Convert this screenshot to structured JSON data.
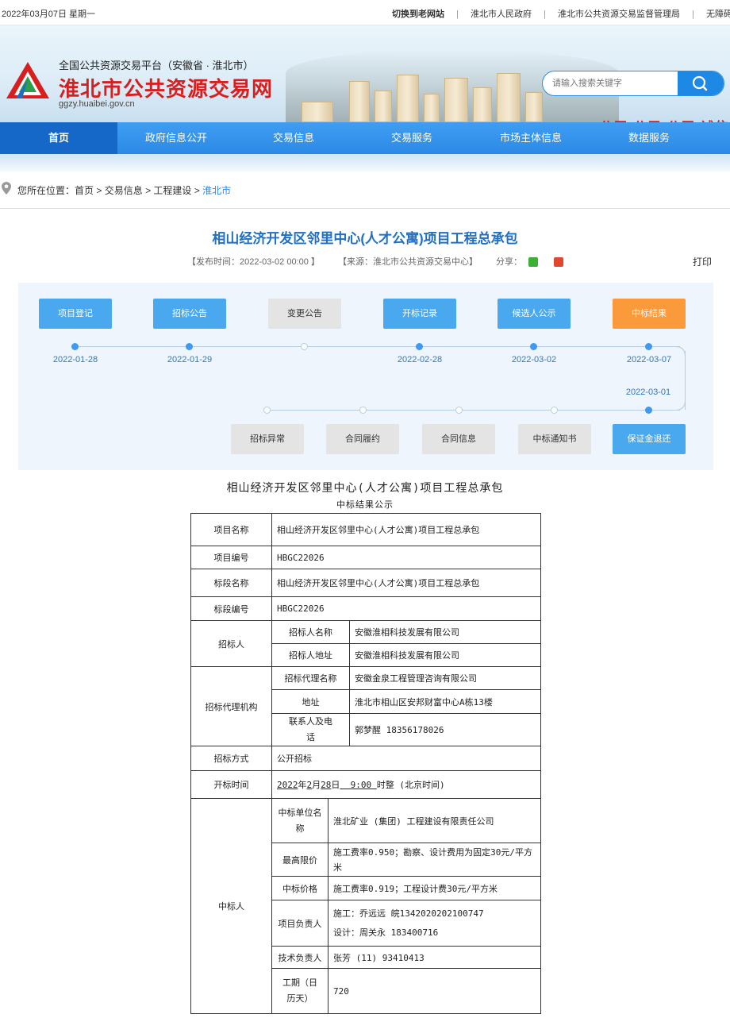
{
  "topbar": {
    "date": "2022年03月07日  星期一",
    "links": [
      "切换到老网站",
      "淮北市人民政府",
      "淮北市公共资源交易监督管理局",
      "无障碍"
    ]
  },
  "header": {
    "platform": "全国公共资源交易平台（安徽省 · 淮北市）",
    "site_title": "淮北市公共资源交易网",
    "site_url": "ggzy.huaibei.gov.cn",
    "slogan": "公开 公平 公正 诚信",
    "search_placeholder": "请输入搜索关键字",
    "search_icon": "search-icon",
    "accent": "#2b8ae6",
    "brand_red": "#d71f1f"
  },
  "nav": {
    "items": [
      "首页",
      "政府信息公开",
      "交易信息",
      "交易服务",
      "市场主体信息",
      "数据服务"
    ],
    "active": 0
  },
  "breadcrumb": {
    "prefix": "您所在位置：",
    "path": [
      "首页",
      "交易信息",
      "工程建设",
      "淮北市"
    ],
    "sep": " > "
  },
  "article": {
    "title": "相山经济开发区邻里中心(人才公寓)项目工程总承包",
    "publish": "【发布时间：2022-03-02 00:00 】",
    "source": "【来源：淮北市公共资源交易中心】",
    "share": "分享：",
    "print": "打印"
  },
  "flow": {
    "top": [
      {
        "label": "项目登记",
        "state": "done",
        "date": "2022-01-28"
      },
      {
        "label": "招标公告",
        "state": "done",
        "date": "2022-01-29"
      },
      {
        "label": "变更公告",
        "state": "none",
        "date": ""
      },
      {
        "label": "开标记录",
        "state": "done",
        "date": "2022-02-28"
      },
      {
        "label": "候选人公示",
        "state": "done",
        "date": "2022-03-02"
      },
      {
        "label": "中标结果",
        "state": "current",
        "date": "2022-03-07"
      }
    ],
    "bottom": [
      {
        "label": "招标异常",
        "state": "none",
        "date": ""
      },
      {
        "label": "合同履约",
        "state": "none",
        "date": ""
      },
      {
        "label": "合同信息",
        "state": "none",
        "date": ""
      },
      {
        "label": "中标通知书",
        "state": "none",
        "date": ""
      },
      {
        "label": "保证金退还",
        "state": "done",
        "date": "2022-03-01"
      }
    ]
  },
  "doc": {
    "title": "相山经济开发区邻里中心(人才公寓)项目工程总承包",
    "subtitle": "中标结果公示",
    "rows": {
      "project_name_label": "项目名称",
      "project_name": "相山经济开发区邻里中心(人才公寓)项目工程总承包",
      "project_no_label": "项目编号",
      "project_no": "HBGC22026",
      "section_name_label": "标段名称",
      "section_name": "相山经济开发区邻里中心(人才公寓)项目工程总承包",
      "section_no_label": "标段编号",
      "section_no": "HBGC22026",
      "tenderer_label": "招标人",
      "tenderer_name_label": "招标人名称",
      "tenderer_name": "安徽淮相科技发展有限公司",
      "tenderer_addr_label": "招标人地址",
      "tenderer_addr": "安徽淮相科技发展有限公司",
      "agency_label": "招标代理机构",
      "agency_name_label": "招标代理名称",
      "agency_name": "安徽金泉工程管理咨询有限公司",
      "agency_addr_label": "地址",
      "agency_addr": "淮北市相山区安邦财富中心A栋13楼",
      "contact_label": "联系人及电话",
      "contact": "郭梦醒     18356178026",
      "method_label": "招标方式",
      "method": "公开招标",
      "open_time_label": "开标时间",
      "open_time_year": "2022",
      "open_time_month": "2",
      "open_time_day": "28",
      "open_time_clock": "9:00",
      "open_time_suffix": "时整 (北京时间)",
      "winner_label": "中标人",
      "winner_name_label": "中标单位名称",
      "winner_name": "淮北矿业 (集团) 工程建设有限责任公司",
      "max_price_label": "最高限价",
      "max_price": "施工费率0.950；勘察、设计费用为固定30元/平方米",
      "win_price_label": "中标价格",
      "win_price": "施工费率0.919；工程设计费30元/平方米",
      "pm_label": "项目负责人",
      "pm_1": "施工：乔远远     皖1342020202100747",
      "pm_2": "设计：周关永     183400716",
      "tech_label": "技术负责人",
      "tech": "张芳      (11) 93410413",
      "period_label": "工期（日历天）",
      "period": "720"
    }
  }
}
